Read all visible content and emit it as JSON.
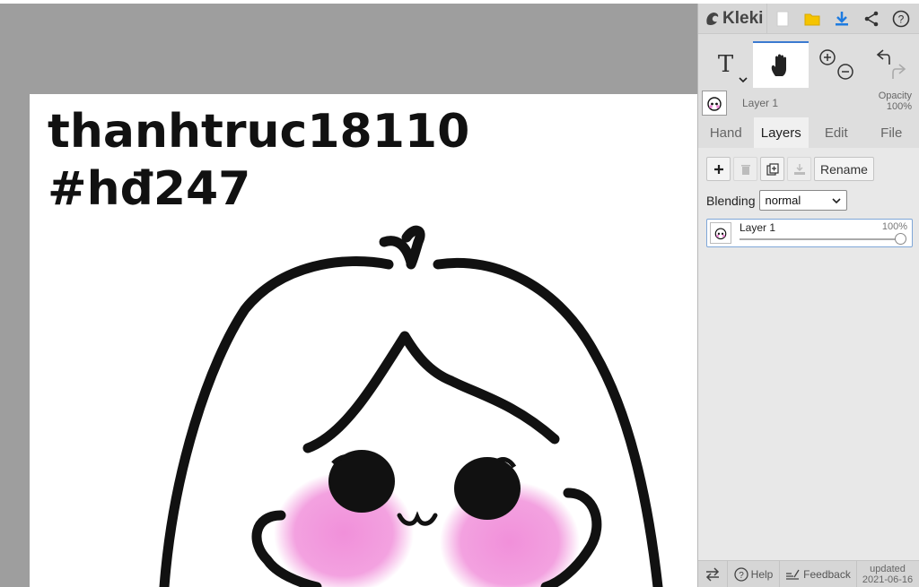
{
  "app": {
    "name": "Kleki"
  },
  "canvas": {
    "text_line1": "thanhtruc18110",
    "text_line2": "#hđ247"
  },
  "topbar": {
    "icons": [
      "new-file-icon",
      "save-icon",
      "download-icon",
      "share-icon",
      "help-icon"
    ]
  },
  "tools": {
    "text_tool": "T",
    "active": "hand"
  },
  "layer_header": {
    "name": "Layer 1",
    "opacity_label": "Opacity",
    "opacity_value": "100%"
  },
  "tabs": [
    {
      "label": "Hand",
      "active": false
    },
    {
      "label": "Layers",
      "active": true
    },
    {
      "label": "Edit",
      "active": false
    },
    {
      "label": "File",
      "active": false
    }
  ],
  "layers_panel": {
    "rename_label": "Rename",
    "blending_label": "Blending",
    "blending_value": "normal",
    "layers": [
      {
        "name": "Layer 1",
        "opacity": "100%",
        "opacity_fraction": 1.0
      }
    ]
  },
  "bottombar": {
    "help_label": "Help",
    "feedback_label": "Feedback",
    "updated_label": "updated",
    "updated_date": "2021-06-16"
  },
  "colors": {
    "accent": "#3b7ad0",
    "canvas_bg": "#9e9e9e",
    "panel_bg": "#dedede",
    "blush": "#f08ad8"
  }
}
